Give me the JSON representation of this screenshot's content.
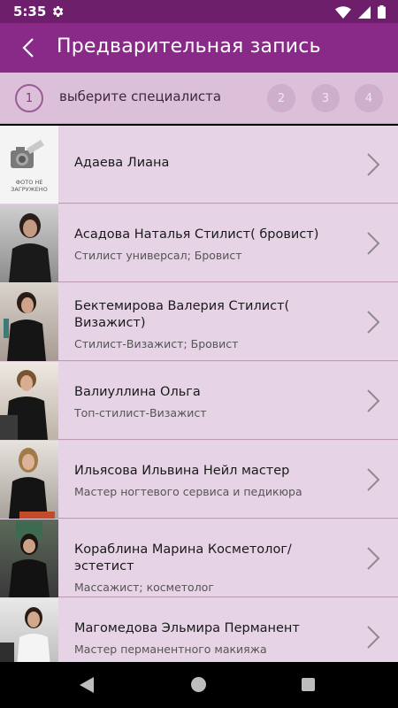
{
  "status": {
    "time": "5:35",
    "icons": [
      "gear-icon",
      "wifi-icon",
      "signal-icon",
      "battery-icon"
    ]
  },
  "header": {
    "title": "Предварительная запись",
    "back_icon": "chevron-left-icon"
  },
  "steps": {
    "current": "1",
    "label": "выберите специалиста",
    "pending": [
      "2",
      "3",
      "4"
    ]
  },
  "specialists": [
    {
      "name": "Адаева Лиана",
      "role": "",
      "photo_note": "ФОТО НЕ ЗАГРУЖЕНО"
    },
    {
      "name": "Асадова Наталья Стилист( бровист)",
      "role": "Стилист универсал; Бровист"
    },
    {
      "name": "Бектемирова Валерия Стилист( Визажист)",
      "role": "Стилист-Визажист; Бровист"
    },
    {
      "name": "Валиуллина Ольга",
      "role": "Топ-стилист-Визажист"
    },
    {
      "name": "Ильясова Ильвина Нейл мастер",
      "role": "Мастер ногтевого сервиса и педикюра"
    },
    {
      "name": "Кораблина Марина Косметолог/эстетист",
      "role": "Массажист; косметолог"
    },
    {
      "name": "Магомедова Эльмира Перманент",
      "role": "Мастер перманентного макияжа"
    }
  ],
  "colors": {
    "status_bar": "#6d1f6b",
    "app_bar": "#8a2a88",
    "steps_bg": "#dcbfd9",
    "row_bg": "#e6d3e5"
  }
}
